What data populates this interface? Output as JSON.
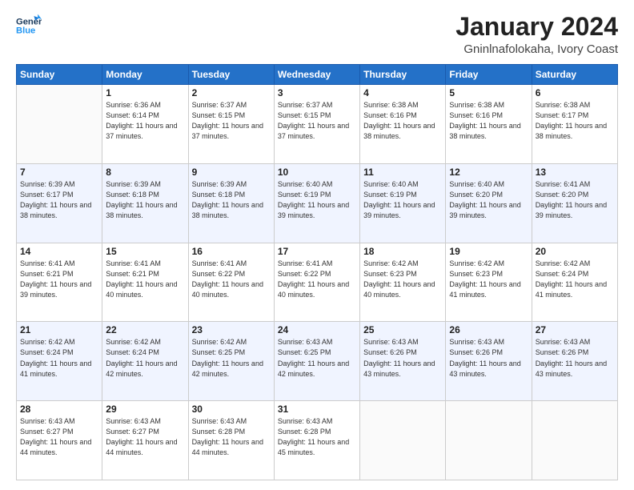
{
  "header": {
    "logo_line1": "General",
    "logo_line2": "Blue",
    "month": "January 2024",
    "location": "Gninlnafolokaha, Ivory Coast"
  },
  "days_of_week": [
    "Sunday",
    "Monday",
    "Tuesday",
    "Wednesday",
    "Thursday",
    "Friday",
    "Saturday"
  ],
  "weeks": [
    [
      {
        "day": "",
        "sunrise": "",
        "sunset": "",
        "daylight": ""
      },
      {
        "day": "1",
        "sunrise": "Sunrise: 6:36 AM",
        "sunset": "Sunset: 6:14 PM",
        "daylight": "Daylight: 11 hours and 37 minutes."
      },
      {
        "day": "2",
        "sunrise": "Sunrise: 6:37 AM",
        "sunset": "Sunset: 6:15 PM",
        "daylight": "Daylight: 11 hours and 37 minutes."
      },
      {
        "day": "3",
        "sunrise": "Sunrise: 6:37 AM",
        "sunset": "Sunset: 6:15 PM",
        "daylight": "Daylight: 11 hours and 37 minutes."
      },
      {
        "day": "4",
        "sunrise": "Sunrise: 6:38 AM",
        "sunset": "Sunset: 6:16 PM",
        "daylight": "Daylight: 11 hours and 38 minutes."
      },
      {
        "day": "5",
        "sunrise": "Sunrise: 6:38 AM",
        "sunset": "Sunset: 6:16 PM",
        "daylight": "Daylight: 11 hours and 38 minutes."
      },
      {
        "day": "6",
        "sunrise": "Sunrise: 6:38 AM",
        "sunset": "Sunset: 6:17 PM",
        "daylight": "Daylight: 11 hours and 38 minutes."
      }
    ],
    [
      {
        "day": "7",
        "sunrise": "Sunrise: 6:39 AM",
        "sunset": "Sunset: 6:17 PM",
        "daylight": "Daylight: 11 hours and 38 minutes."
      },
      {
        "day": "8",
        "sunrise": "Sunrise: 6:39 AM",
        "sunset": "Sunset: 6:18 PM",
        "daylight": "Daylight: 11 hours and 38 minutes."
      },
      {
        "day": "9",
        "sunrise": "Sunrise: 6:39 AM",
        "sunset": "Sunset: 6:18 PM",
        "daylight": "Daylight: 11 hours and 38 minutes."
      },
      {
        "day": "10",
        "sunrise": "Sunrise: 6:40 AM",
        "sunset": "Sunset: 6:19 PM",
        "daylight": "Daylight: 11 hours and 39 minutes."
      },
      {
        "day": "11",
        "sunrise": "Sunrise: 6:40 AM",
        "sunset": "Sunset: 6:19 PM",
        "daylight": "Daylight: 11 hours and 39 minutes."
      },
      {
        "day": "12",
        "sunrise": "Sunrise: 6:40 AM",
        "sunset": "Sunset: 6:20 PM",
        "daylight": "Daylight: 11 hours and 39 minutes."
      },
      {
        "day": "13",
        "sunrise": "Sunrise: 6:41 AM",
        "sunset": "Sunset: 6:20 PM",
        "daylight": "Daylight: 11 hours and 39 minutes."
      }
    ],
    [
      {
        "day": "14",
        "sunrise": "Sunrise: 6:41 AM",
        "sunset": "Sunset: 6:21 PM",
        "daylight": "Daylight: 11 hours and 39 minutes."
      },
      {
        "day": "15",
        "sunrise": "Sunrise: 6:41 AM",
        "sunset": "Sunset: 6:21 PM",
        "daylight": "Daylight: 11 hours and 40 minutes."
      },
      {
        "day": "16",
        "sunrise": "Sunrise: 6:41 AM",
        "sunset": "Sunset: 6:22 PM",
        "daylight": "Daylight: 11 hours and 40 minutes."
      },
      {
        "day": "17",
        "sunrise": "Sunrise: 6:41 AM",
        "sunset": "Sunset: 6:22 PM",
        "daylight": "Daylight: 11 hours and 40 minutes."
      },
      {
        "day": "18",
        "sunrise": "Sunrise: 6:42 AM",
        "sunset": "Sunset: 6:23 PM",
        "daylight": "Daylight: 11 hours and 40 minutes."
      },
      {
        "day": "19",
        "sunrise": "Sunrise: 6:42 AM",
        "sunset": "Sunset: 6:23 PM",
        "daylight": "Daylight: 11 hours and 41 minutes."
      },
      {
        "day": "20",
        "sunrise": "Sunrise: 6:42 AM",
        "sunset": "Sunset: 6:24 PM",
        "daylight": "Daylight: 11 hours and 41 minutes."
      }
    ],
    [
      {
        "day": "21",
        "sunrise": "Sunrise: 6:42 AM",
        "sunset": "Sunset: 6:24 PM",
        "daylight": "Daylight: 11 hours and 41 minutes."
      },
      {
        "day": "22",
        "sunrise": "Sunrise: 6:42 AM",
        "sunset": "Sunset: 6:24 PM",
        "daylight": "Daylight: 11 hours and 42 minutes."
      },
      {
        "day": "23",
        "sunrise": "Sunrise: 6:42 AM",
        "sunset": "Sunset: 6:25 PM",
        "daylight": "Daylight: 11 hours and 42 minutes."
      },
      {
        "day": "24",
        "sunrise": "Sunrise: 6:43 AM",
        "sunset": "Sunset: 6:25 PM",
        "daylight": "Daylight: 11 hours and 42 minutes."
      },
      {
        "day": "25",
        "sunrise": "Sunrise: 6:43 AM",
        "sunset": "Sunset: 6:26 PM",
        "daylight": "Daylight: 11 hours and 43 minutes."
      },
      {
        "day": "26",
        "sunrise": "Sunrise: 6:43 AM",
        "sunset": "Sunset: 6:26 PM",
        "daylight": "Daylight: 11 hours and 43 minutes."
      },
      {
        "day": "27",
        "sunrise": "Sunrise: 6:43 AM",
        "sunset": "Sunset: 6:26 PM",
        "daylight": "Daylight: 11 hours and 43 minutes."
      }
    ],
    [
      {
        "day": "28",
        "sunrise": "Sunrise: 6:43 AM",
        "sunset": "Sunset: 6:27 PM",
        "daylight": "Daylight: 11 hours and 44 minutes."
      },
      {
        "day": "29",
        "sunrise": "Sunrise: 6:43 AM",
        "sunset": "Sunset: 6:27 PM",
        "daylight": "Daylight: 11 hours and 44 minutes."
      },
      {
        "day": "30",
        "sunrise": "Sunrise: 6:43 AM",
        "sunset": "Sunset: 6:28 PM",
        "daylight": "Daylight: 11 hours and 44 minutes."
      },
      {
        "day": "31",
        "sunrise": "Sunrise: 6:43 AM",
        "sunset": "Sunset: 6:28 PM",
        "daylight": "Daylight: 11 hours and 45 minutes."
      },
      {
        "day": "",
        "sunrise": "",
        "sunset": "",
        "daylight": ""
      },
      {
        "day": "",
        "sunrise": "",
        "sunset": "",
        "daylight": ""
      },
      {
        "day": "",
        "sunrise": "",
        "sunset": "",
        "daylight": ""
      }
    ]
  ]
}
